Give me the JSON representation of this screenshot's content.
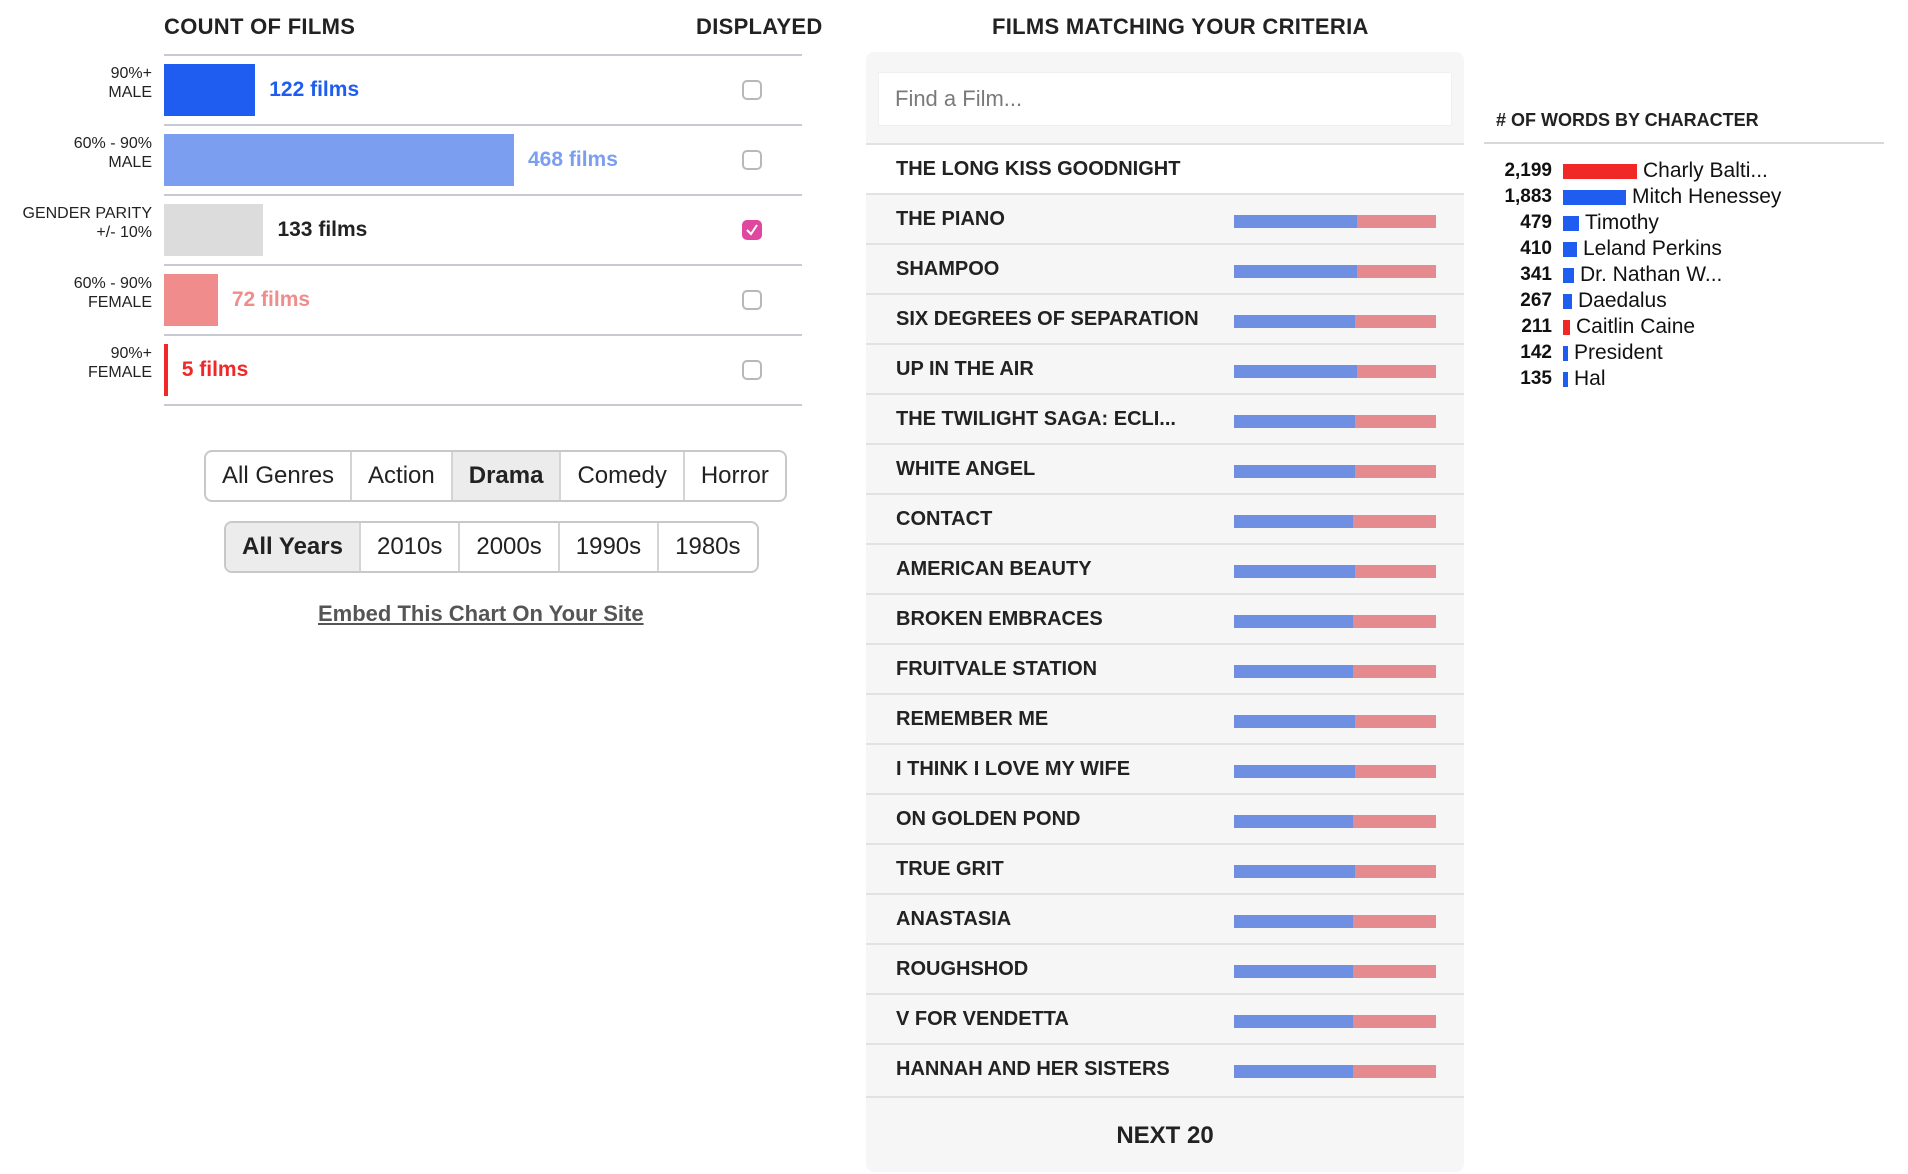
{
  "headers": {
    "count_of_films": "COUNT OF FILMS",
    "displayed": "DISPLAYED",
    "films_matching": "FILMS MATCHING YOUR CRITERIA",
    "words_by_character": "# OF WORDS BY CHARACTER"
  },
  "colors": {
    "male_strong": "#1f5cf0",
    "male_light": "#7b9ef0",
    "parity": "#dcdcdc",
    "female_light": "#f08c8c",
    "female_strong": "#f02828",
    "check_accent": "#e0479e"
  },
  "chart_data": [
    {
      "type": "bar",
      "title": "COUNT OF FILMS",
      "categories": [
        "90%+ MALE",
        "60% - 90% MALE",
        "GENDER PARITY +/- 10%",
        "60% - 90% FEMALE",
        "90%+ FEMALE"
      ],
      "category_lines": [
        [
          "90%+",
          "MALE"
        ],
        [
          "60% - 90%",
          "MALE"
        ],
        [
          "GENDER PARITY",
          "+/- 10%"
        ],
        [
          "60% - 90%",
          "FEMALE"
        ],
        [
          "90%+",
          "FEMALE"
        ]
      ],
      "values": [
        122,
        468,
        133,
        72,
        5
      ],
      "value_labels": [
        "122 films",
        "468 films",
        "133 films",
        "72 films",
        "5 films"
      ],
      "displayed": [
        false,
        false,
        true,
        false,
        false
      ]
    },
    {
      "type": "bar",
      "title": "# OF WORDS BY CHARACTER",
      "categories": [
        "Charly Balti...",
        "Mitch Henessey",
        "Timothy",
        "Leland Perkins",
        "Dr. Nathan W...",
        "Daedalus",
        "Caitlin Caine",
        "President",
        "Hal"
      ],
      "values": [
        2199,
        1883,
        479,
        410,
        341,
        267,
        211,
        142,
        135
      ],
      "value_labels": [
        "2,199",
        "1,883",
        "479",
        "410",
        "341",
        "267",
        "211",
        "142",
        "135"
      ],
      "gender": [
        "female",
        "male",
        "male",
        "male",
        "male",
        "male",
        "female",
        "male",
        "male"
      ]
    }
  ],
  "filters": {
    "genres": [
      "All Genres",
      "Action",
      "Drama",
      "Comedy",
      "Horror"
    ],
    "genre_selected": "Drama",
    "years": [
      "All Years",
      "2010s",
      "2000s",
      "1990s",
      "1980s"
    ],
    "year_selected": "All Years"
  },
  "embed_link": "Embed This Chart On Your Site",
  "search": {
    "placeholder": "Find a Film...",
    "value": ""
  },
  "films": [
    {
      "title": "THE LONG KISS GOODNIGHT",
      "male_share": null
    },
    {
      "title": "THE PIANO",
      "male_share": 0.61
    },
    {
      "title": "SHAMPOO",
      "male_share": 0.61
    },
    {
      "title": "SIX DEGREES OF SEPARATION",
      "male_share": 0.6
    },
    {
      "title": "UP IN THE AIR",
      "male_share": 0.61
    },
    {
      "title": "THE TWILIGHT SAGA: ECLI...",
      "male_share": 0.6
    },
    {
      "title": "WHITE ANGEL",
      "male_share": 0.6
    },
    {
      "title": "CONTACT",
      "male_share": 0.59
    },
    {
      "title": "AMERICAN BEAUTY",
      "male_share": 0.6
    },
    {
      "title": "BROKEN EMBRACES",
      "male_share": 0.59
    },
    {
      "title": "FRUITVALE STATION",
      "male_share": 0.59
    },
    {
      "title": "REMEMBER ME",
      "male_share": 0.6
    },
    {
      "title": "I THINK I LOVE MY WIFE",
      "male_share": 0.6
    },
    {
      "title": "ON GOLDEN POND",
      "male_share": 0.59
    },
    {
      "title": "TRUE GRIT",
      "male_share": 0.6
    },
    {
      "title": "ANASTASIA",
      "male_share": 0.59
    },
    {
      "title": "ROUGHSHOD",
      "male_share": 0.59
    },
    {
      "title": "V FOR VENDETTA",
      "male_share": 0.59
    },
    {
      "title": "HANNAH AND HER SISTERS",
      "male_share": 0.59
    }
  ],
  "next_button": "NEXT 20"
}
